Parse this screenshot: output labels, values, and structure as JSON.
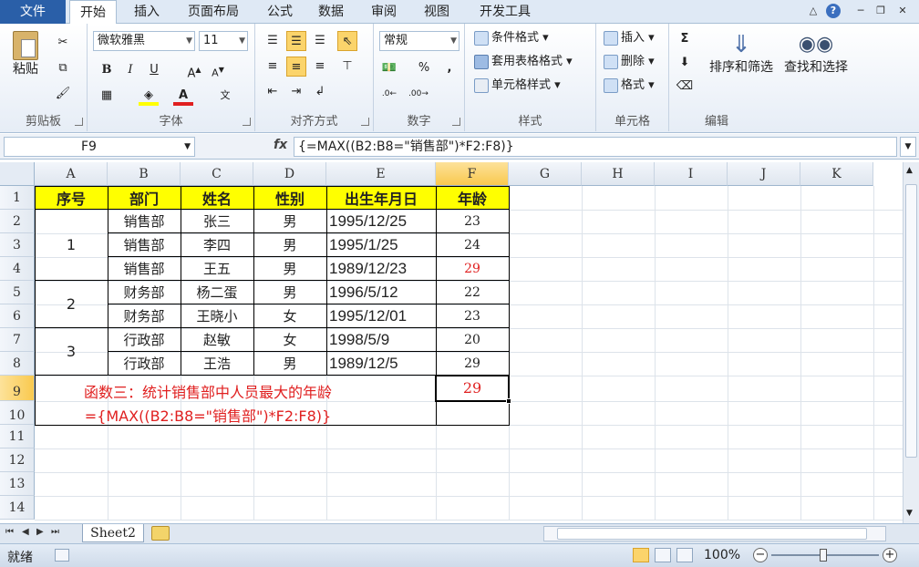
{
  "tabs": {
    "file": "文件",
    "items": [
      "开始",
      "插入",
      "页面布局",
      "公式",
      "数据",
      "审阅",
      "视图",
      "开发工具"
    ]
  },
  "ribbon": {
    "clipboard": {
      "paste": "粘贴",
      "label": "剪贴板"
    },
    "font": {
      "name": "微软雅黑",
      "size": "11",
      "label": "字体",
      "bold": "B",
      "italic": "I",
      "underline": "U"
    },
    "alignment": {
      "label": "对齐方式"
    },
    "number": {
      "format": "常规",
      "label": "数字"
    },
    "styles": {
      "conditional": "条件格式",
      "table": "套用表格格式",
      "cell": "单元格样式",
      "label": "样式"
    },
    "cells": {
      "insert": "插入",
      "delete": "删除",
      "format": "格式",
      "label": "单元格"
    },
    "editing": {
      "sort": "排序和筛选",
      "find": "查找和选择",
      "label": "编辑"
    }
  },
  "formula_bar": {
    "name_box": "F9",
    "fx": "fx",
    "formula": "{=MAX((B2:B8=\"销售部\")*F2:F8)}"
  },
  "columns": [
    "A",
    "B",
    "C",
    "D",
    "E",
    "F",
    "G",
    "H",
    "I",
    "J",
    "K"
  ],
  "rows": [
    "1",
    "2",
    "3",
    "4",
    "5",
    "6",
    "7",
    "8",
    "9",
    "10",
    "11",
    "12",
    "13",
    "14"
  ],
  "table": {
    "headers": [
      "序号",
      "部门",
      "姓名",
      "性别",
      "出生年月日",
      "年龄"
    ],
    "groups": [
      "1",
      "2",
      "3"
    ],
    "records": [
      [
        "销售部",
        "张三",
        "男",
        "1995/12/25",
        "23"
      ],
      [
        "销售部",
        "李四",
        "男",
        "1995/1/25",
        "24"
      ],
      [
        "销售部",
        "王五",
        "男",
        "1989/12/23",
        "29"
      ],
      [
        "财务部",
        "杨二蛋",
        "男",
        "1996/5/12",
        "22"
      ],
      [
        "财务部",
        "王晓小",
        "女",
        "1995/12/01",
        "23"
      ],
      [
        "行政部",
        "赵敏",
        "女",
        "1998/5/9",
        "20"
      ],
      [
        "行政部",
        "王浩",
        "男",
        "1989/12/5",
        "29"
      ]
    ],
    "result": "29",
    "note_line1": "函数三：统计销售部中人员最大的年龄",
    "note_line2": "={MAX((B2:B8=\"销售部\")*F2:F8)}"
  },
  "sheet_tab": "Sheet2",
  "status": {
    "ready": "就绪",
    "zoom": "100%"
  },
  "colors": {
    "header_fill": "#ffff00",
    "highlight_red": "#e02020",
    "file_tab": "#2a5fa8"
  }
}
